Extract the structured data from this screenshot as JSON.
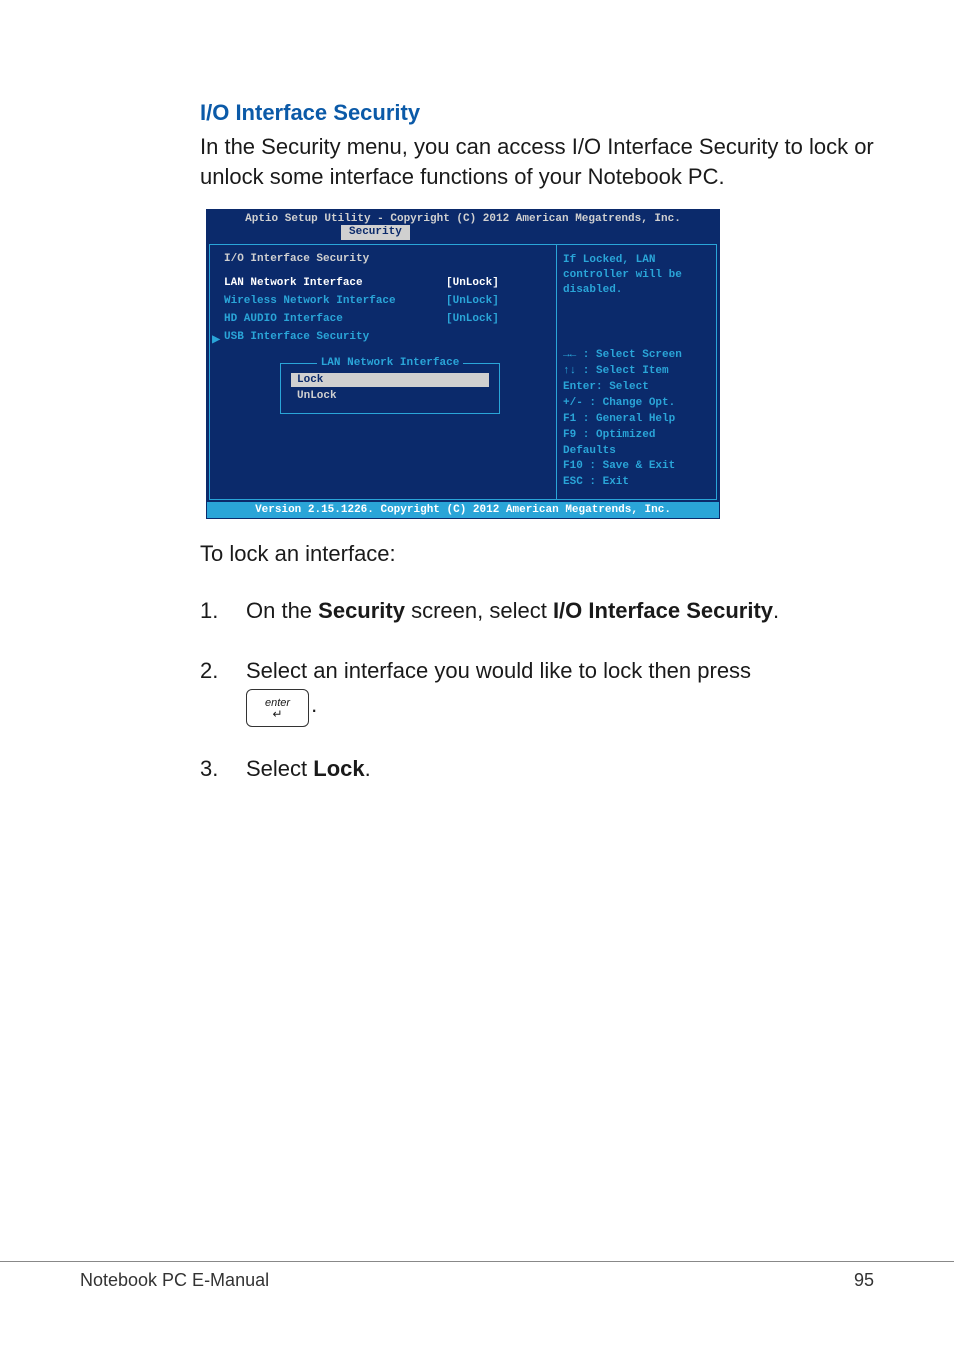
{
  "section": {
    "heading": "I/O Interface Security",
    "intro": "In the Security menu, you can access I/O Interface Security to lock or unlock some interface functions of your Notebook PC."
  },
  "bios": {
    "titlebar": "Aptio Setup Utility - Copyright (C) 2012 American Megatrends, Inc.",
    "tab": "Security",
    "panel_heading": "I/O Interface Security",
    "rows": [
      {
        "label": "LAN Network Interface",
        "value": "[UnLock]",
        "selected": true
      },
      {
        "label": "Wireless Network Interface",
        "value": "[UnLock]",
        "selected": false
      },
      {
        "label": "HD AUDIO Interface",
        "value": "[UnLock]",
        "selected": false
      }
    ],
    "submenu": "USB Interface Security",
    "popup": {
      "title": "LAN Network Interface",
      "options": [
        "Lock",
        "UnLock"
      ],
      "selected_index": 0
    },
    "help_top": "If Locked, LAN controller will be disabled.",
    "help_keys": [
      "→←  : Select Screen",
      "↑↓  : Select Item",
      "Enter: Select",
      "+/-  : Change Opt.",
      "F1   : General Help",
      "F9   : Optimized Defaults",
      "F10  : Save & Exit",
      "ESC  : Exit"
    ],
    "footer": "Version 2.15.1226. Copyright (C) 2012 American Megatrends, Inc."
  },
  "body": {
    "lead": "To lock an interface:",
    "steps": {
      "s1_num": "1.",
      "s1_a": "On the ",
      "s1_b": "Security",
      "s1_c": " screen, select ",
      "s1_d": "I/O Interface Security",
      "s1_e": ".",
      "s2_num": "2.",
      "s2_a": "Select an interface you would like to lock then press ",
      "s2_key": "enter",
      "s2_b": ".",
      "s3_num": "3.",
      "s3_a": "Select ",
      "s3_b": "Lock",
      "s3_c": "."
    }
  },
  "footer": {
    "left": "Notebook PC E-Manual",
    "right": "95"
  }
}
